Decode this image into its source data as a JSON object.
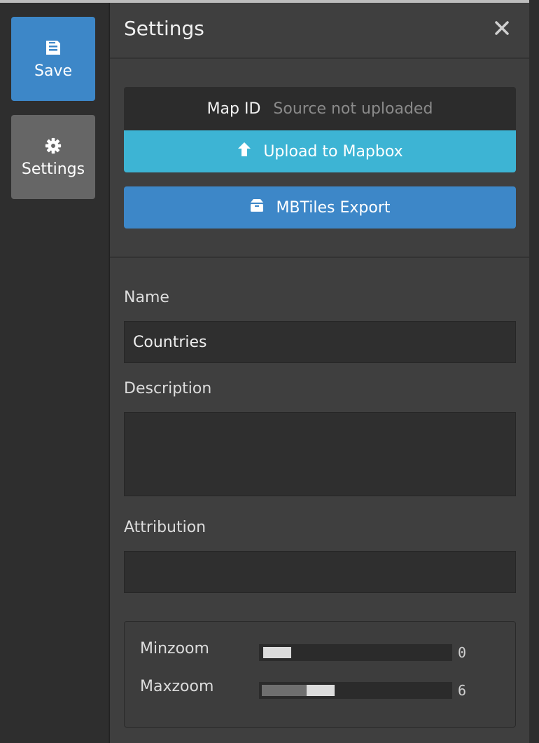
{
  "sidebar": {
    "save_label": "Save",
    "settings_label": "Settings"
  },
  "panel": {
    "title": "Settings",
    "map_id": {
      "label": "Map ID",
      "value": "Source not uploaded"
    },
    "upload_label": "Upload to Mapbox",
    "export_label": "MBTiles Export"
  },
  "form": {
    "name_label": "Name",
    "name_value": "Countries",
    "description_label": "Description",
    "description_value": "",
    "attribution_label": "Attribution",
    "attribution_value": ""
  },
  "zoom": {
    "min_label": "Minzoom",
    "min_value": "0",
    "max_label": "Maxzoom",
    "max_value": "6"
  },
  "colors": {
    "save": "#3d87c8",
    "upload": "#3db4d4",
    "export": "#3d87c8",
    "settings_active": "#666666"
  },
  "icons": {
    "save": "floppy-disk-icon",
    "settings": "gear-icon",
    "close": "close-icon",
    "upload": "arrow-up-icon",
    "export": "box-icon"
  }
}
